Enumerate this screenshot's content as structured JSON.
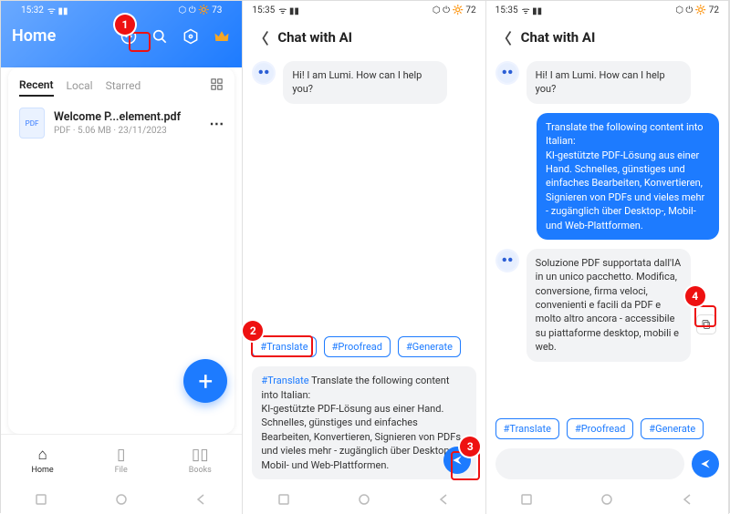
{
  "panel1": {
    "status": {
      "time": "15:32",
      "sig": "ᯤ ▮▮",
      "right": "⬡ ⏻ 🔆 73"
    },
    "title": "Home",
    "tabs": {
      "recent": "Recent",
      "local": "Local",
      "starred": "Starred"
    },
    "file": {
      "name": "Welcome P...element.pdf",
      "sub": "PDF · 5.06 MB · 23/11/2023",
      "badge": "PDF"
    },
    "nav": {
      "home": "Home",
      "file": "File",
      "books": "Books"
    }
  },
  "panel2": {
    "status": {
      "time": "15:35",
      "sig": "ᯤ ▮▮",
      "right": "⬡ ⏻ 🔆 72"
    },
    "header": "Chat with AI",
    "greeting": "Hi! I am Lumi. How can I help you?",
    "chips": {
      "translate": "#Translate",
      "proofread": "#Proofread",
      "generate": "#Generate"
    },
    "input": {
      "tag": "#Translate",
      "text": " Translate the following content into Italian:\nKI-gestützte PDF-Lösung aus einer Hand. Schnelles, günstiges und einfaches Bearbeiten, Konvertieren, Signieren von PDFs und vieles mehr - zugänglich über Desktop-, Mobil- und Web-Plattformen."
    }
  },
  "panel3": {
    "status": {
      "time": "15:35",
      "sig": "ᯤ ▮▮",
      "right": "⬡ ⏻ 🔆 72"
    },
    "header": "Chat with AI",
    "greeting": "Hi! I am Lumi. How can I help you?",
    "userMsg": "Translate the following content into Italian:\nKI-gestützte PDF-Lösung aus einer Hand. Schnelles, günstiges und einfaches Bearbeiten, Konvertieren, Signieren von PDFs und vieles mehr - zugänglich über Desktop-, Mobil- und Web-Plattformen.",
    "aiReply": "Soluzione PDF supportata dall'IA in un unico pacchetto. Modifica, conversione, firma veloci, convenienti e facili da PDF e molto altro ancora - accessibile su piattaforme desktop, mobili e web.",
    "chips": {
      "translate": "#Translate",
      "proofread": "#Proofread",
      "generate": "#Generate"
    }
  },
  "annotations": {
    "a1": "1",
    "a2": "2",
    "a3": "3",
    "a4": "4"
  }
}
